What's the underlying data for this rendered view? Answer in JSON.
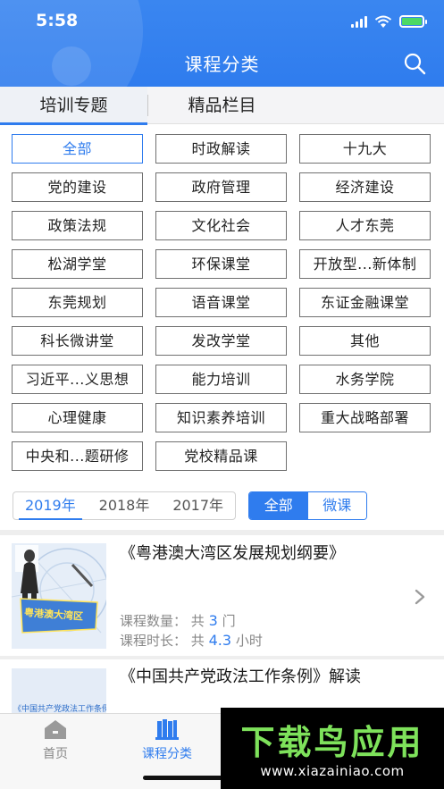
{
  "status_bar": {
    "time": "5:58"
  },
  "header": {
    "title": "课程分类"
  },
  "top_tabs": [
    {
      "label": "培训专题",
      "active": true
    },
    {
      "label": "精品栏目",
      "active": false
    }
  ],
  "categories": [
    "全部",
    "时政解读",
    "十九大",
    "党的建设",
    "政府管理",
    "经济建设",
    "政策法规",
    "文化社会",
    "人才东莞",
    "松湖学堂",
    "环保课堂",
    "开放型...新体制",
    "东莞规划",
    "语音课堂",
    "东证金融课堂",
    "科长微讲堂",
    "发改学堂",
    "其他",
    "习近平...义思想",
    "能力培训",
    "水务学院",
    "心理健康",
    "知识素养培训",
    "重大战略部署",
    "中央和...题研修",
    "党校精品课"
  ],
  "active_category": "全部",
  "year_tabs": [
    {
      "label": "2019年",
      "active": true
    },
    {
      "label": "2018年",
      "active": false
    },
    {
      "label": "2017年",
      "active": false
    }
  ],
  "type_filter": [
    {
      "label": "全部",
      "active": true
    },
    {
      "label": "微课",
      "active": false
    }
  ],
  "courses": [
    {
      "title": "《粤港澳大湾区发展规划纲要》",
      "count_label": "课程数量：",
      "count_prefix": "共",
      "count_value": "3",
      "count_unit": "门",
      "duration_label": "课程时长：",
      "duration_prefix": "共",
      "duration_value": "4.3",
      "duration_unit": "小时",
      "thumb_text": "粤港澳大湾区"
    },
    {
      "title": "《中国共产党政法工作条例》解读",
      "thumb_text": "《中国共产党政法工作条例》解读"
    }
  ],
  "bottom_nav": [
    {
      "label": "首页",
      "active": false
    },
    {
      "label": "课程分类",
      "active": true
    }
  ],
  "watermark": {
    "main": "下载鸟应用",
    "url": "www.xiazainiao.com"
  },
  "colors": {
    "accent": "#2f7cee",
    "watermark_green": "#7ee25b"
  },
  "icons": [
    "search-icon",
    "wifi-icon",
    "signal-icon",
    "battery-icon",
    "chevron-right-icon",
    "home-icon",
    "books-icon"
  ]
}
